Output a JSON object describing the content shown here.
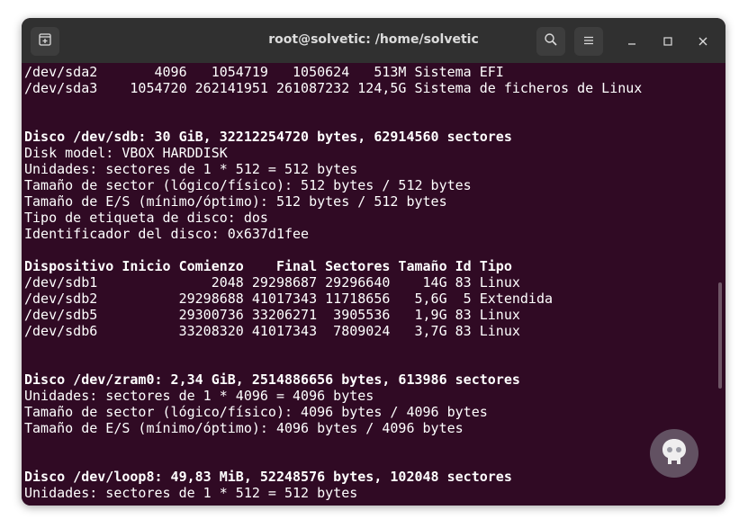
{
  "window": {
    "title": "root@solvetic: /home/solvetic"
  },
  "icons": {
    "new_tab": "new-tab-icon",
    "search": "search-icon",
    "menu": "hamburger-menu-icon",
    "minimize": "minimize-icon",
    "maximize": "maximize-icon",
    "close": "close-icon",
    "watermark": "solvetic-logo-icon"
  },
  "colors": {
    "terminal_bg": "#300a24",
    "titlebar_bg": "#303030",
    "text": "#ffffff"
  },
  "terminal": {
    "lines": [
      {
        "text": "/dev/sda2       4096   1054719   1050624   513M Sistema EFI",
        "bold": false
      },
      {
        "text": "/dev/sda3    1054720 262141951 261087232 124,5G Sistema de ficheros de Linux",
        "bold": false
      },
      {
        "text": "",
        "bold": false
      },
      {
        "text": "",
        "bold": false
      },
      {
        "text": "Disco /dev/sdb: 30 GiB, 32212254720 bytes, 62914560 sectores",
        "bold": true
      },
      {
        "text": "Disk model: VBOX HARDDISK",
        "bold": false
      },
      {
        "text": "Unidades: sectores de 1 * 512 = 512 bytes",
        "bold": false
      },
      {
        "text": "Tamaño de sector (lógico/físico): 512 bytes / 512 bytes",
        "bold": false
      },
      {
        "text": "Tamaño de E/S (mínimo/óptimo): 512 bytes / 512 bytes",
        "bold": false
      },
      {
        "text": "Tipo de etiqueta de disco: dos",
        "bold": false
      },
      {
        "text": "Identificador del disco: 0x637d1fee",
        "bold": false
      },
      {
        "text": "",
        "bold": false
      },
      {
        "text": "Dispositivo Inicio Comienzo    Final Sectores Tamaño Id Tipo",
        "bold": true
      },
      {
        "text": "/dev/sdb1              2048 29298687 29296640    14G 83 Linux",
        "bold": false
      },
      {
        "text": "/dev/sdb2          29298688 41017343 11718656   5,6G  5 Extendida",
        "bold": false
      },
      {
        "text": "/dev/sdb5          29300736 33206271  3905536   1,9G 83 Linux",
        "bold": false
      },
      {
        "text": "/dev/sdb6          33208320 41017343  7809024   3,7G 83 Linux",
        "bold": false
      },
      {
        "text": "",
        "bold": false
      },
      {
        "text": "",
        "bold": false
      },
      {
        "text": "Disco /dev/zram0: 2,34 GiB, 2514886656 bytes, 613986 sectores",
        "bold": true
      },
      {
        "text": "Unidades: sectores de 1 * 4096 = 4096 bytes",
        "bold": false
      },
      {
        "text": "Tamaño de sector (lógico/físico): 4096 bytes / 4096 bytes",
        "bold": false
      },
      {
        "text": "Tamaño de E/S (mínimo/óptimo): 4096 bytes / 4096 bytes",
        "bold": false
      },
      {
        "text": "",
        "bold": false
      },
      {
        "text": "",
        "bold": false
      },
      {
        "text": "Disco /dev/loop8: 49,83 MiB, 52248576 bytes, 102048 sectores",
        "bold": true
      },
      {
        "text": "Unidades: sectores de 1 * 512 = 512 bytes",
        "bold": false
      }
    ]
  }
}
